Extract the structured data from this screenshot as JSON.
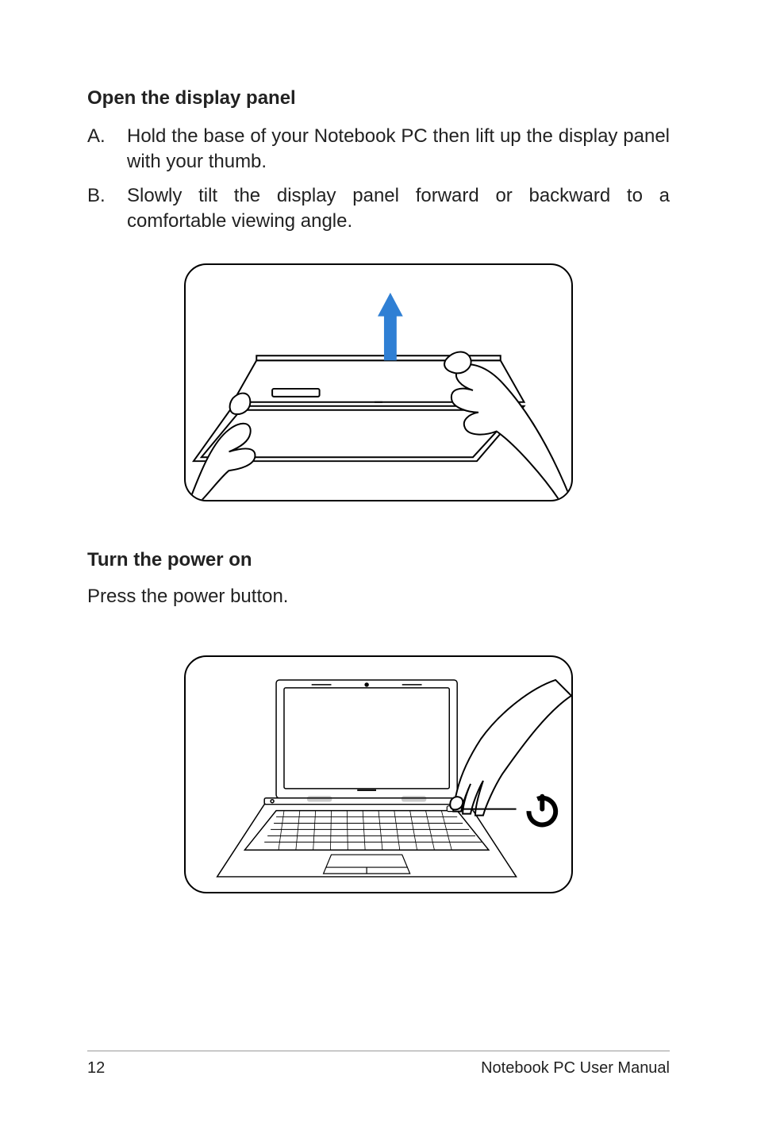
{
  "section1": {
    "heading": "Open the display panel",
    "items": [
      {
        "marker": "A.",
        "text": "Hold the base of your Notebook PC then lift up the display panel with your thumb."
      },
      {
        "marker": "B.",
        "text": "Slowly tilt the display panel forward or backward to a comfortable viewing angle."
      }
    ]
  },
  "section2": {
    "heading": "Turn the power on",
    "body": "Press the power button."
  },
  "footer": {
    "page_number": "12",
    "doc_title": "Notebook PC User Manual"
  }
}
